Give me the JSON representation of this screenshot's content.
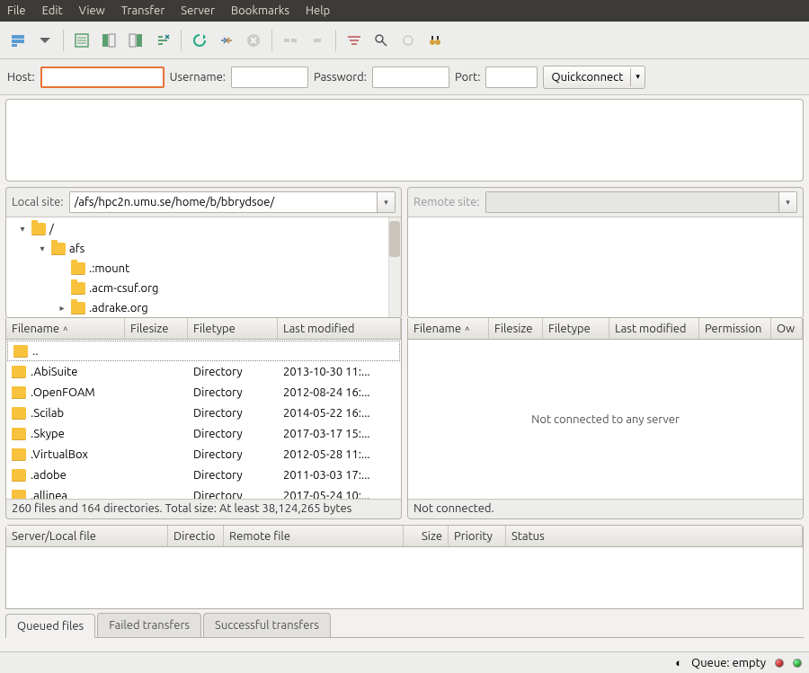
{
  "menu": {
    "file": "File",
    "edit": "Edit",
    "view": "View",
    "transfer": "Transfer",
    "server": "Server",
    "bookmarks": "Bookmarks",
    "help": "Help"
  },
  "quick": {
    "host_label": "Host:",
    "user_label": "Username:",
    "pass_label": "Password:",
    "port_label": "Port:",
    "host": "",
    "user": "",
    "pass": "",
    "port": "",
    "connect": "Quickconnect"
  },
  "local": {
    "label": "Local site:",
    "path": "/afs/hpc2n.umu.se/home/b/bbrydsoe/",
    "tree": [
      {
        "indent": 0,
        "tw": "▾",
        "name": "/"
      },
      {
        "indent": 1,
        "tw": "▾",
        "name": "afs"
      },
      {
        "indent": 2,
        "tw": "",
        "name": ".:mount"
      },
      {
        "indent": 2,
        "tw": "",
        "name": ".acm-csuf.org"
      },
      {
        "indent": 2,
        "tw": "▸",
        "name": ".adrake.org"
      }
    ],
    "cols": {
      "name": "Filename",
      "size": "Filesize",
      "type": "Filetype",
      "mod": "Last modified"
    },
    "files": [
      {
        "name": "..",
        "type": "",
        "mod": "",
        "up": true
      },
      {
        "name": ".AbiSuite",
        "type": "Directory",
        "mod": "2013-10-30 11:..."
      },
      {
        "name": ".OpenFOAM",
        "type": "Directory",
        "mod": "2012-08-24 16:..."
      },
      {
        "name": ".Scilab",
        "type": "Directory",
        "mod": "2014-05-22 16:..."
      },
      {
        "name": ".Skype",
        "type": "Directory",
        "mod": "2017-03-17 15:..."
      },
      {
        "name": ".VirtualBox",
        "type": "Directory",
        "mod": "2012-05-28 11:..."
      },
      {
        "name": ".adobe",
        "type": "Directory",
        "mod": "2011-03-03 17:..."
      },
      {
        "name": ".allinea",
        "type": "Directory",
        "mod": "2017-05-24 10:..."
      }
    ],
    "status": "260 files and 164 directories. Total size: At least 38,124,265 bytes"
  },
  "remote": {
    "label": "Remote site:",
    "path": "",
    "cols": {
      "name": "Filename",
      "size": "Filesize",
      "type": "Filetype",
      "mod": "Last modified",
      "perm": "Permission",
      "own": "Ow"
    },
    "empty": "Not connected to any server",
    "status": "Not connected."
  },
  "queue": {
    "cols": {
      "server": "Server/Local file",
      "dir": "Directio",
      "remote": "Remote file",
      "size": "Size",
      "prio": "Priority",
      "status": "Status"
    }
  },
  "tabs": {
    "queued": "Queued files",
    "failed": "Failed transfers",
    "success": "Successful transfers"
  },
  "statusbar": {
    "queue": "Queue: empty"
  }
}
